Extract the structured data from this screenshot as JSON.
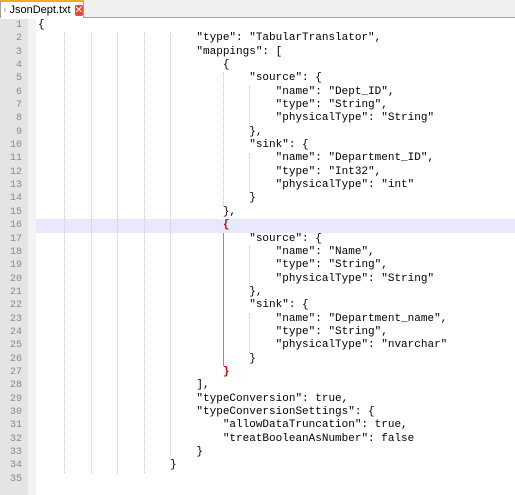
{
  "tab": {
    "title": "JsonDept.txt"
  },
  "editor": {
    "current_line": 16,
    "lines": [
      {
        "n": "1",
        "text": "{"
      },
      {
        "n": "2",
        "text": "                        \"type\": \"TabularTranslator\","
      },
      {
        "n": "3",
        "text": "                        \"mappings\": ["
      },
      {
        "n": "4",
        "text": "                            {"
      },
      {
        "n": "5",
        "text": "                                \"source\": {"
      },
      {
        "n": "6",
        "text": "                                    \"name\": \"Dept_ID\","
      },
      {
        "n": "7",
        "text": "                                    \"type\": \"String\","
      },
      {
        "n": "8",
        "text": "                                    \"physicalType\": \"String\""
      },
      {
        "n": "9",
        "text": "                                },"
      },
      {
        "n": "10",
        "text": "                                \"sink\": {"
      },
      {
        "n": "11",
        "text": "                                    \"name\": \"Department_ID\","
      },
      {
        "n": "12",
        "text": "                                    \"type\": \"Int32\","
      },
      {
        "n": "13",
        "text": "                                    \"physicalType\": \"int\""
      },
      {
        "n": "14",
        "text": "                                }"
      },
      {
        "n": "15",
        "text": "                            },"
      },
      {
        "n": "16",
        "text": "                            {"
      },
      {
        "n": "17",
        "text": "                                \"source\": {"
      },
      {
        "n": "18",
        "text": "                                    \"name\": \"Name\","
      },
      {
        "n": "19",
        "text": "                                    \"type\": \"String\","
      },
      {
        "n": "20",
        "text": "                                    \"physicalType\": \"String\""
      },
      {
        "n": "21",
        "text": "                                },"
      },
      {
        "n": "22",
        "text": "                                \"sink\": {"
      },
      {
        "n": "23",
        "text": "                                    \"name\": \"Department_name\","
      },
      {
        "n": "24",
        "text": "                                    \"type\": \"String\","
      },
      {
        "n": "25",
        "text": "                                    \"physicalType\": \"nvarchar\""
      },
      {
        "n": "26",
        "text": "                                }"
      },
      {
        "n": "27",
        "text": "                            }"
      },
      {
        "n": "28",
        "text": "                        ],"
      },
      {
        "n": "29",
        "text": "                        \"typeConversion\": true,"
      },
      {
        "n": "30",
        "text": "                        \"typeConversionSettings\": {"
      },
      {
        "n": "31",
        "text": "                            \"allowDataTruncation\": true,"
      },
      {
        "n": "32",
        "text": "                            \"treatBooleanAsNumber\": false"
      },
      {
        "n": "33",
        "text": "                        }"
      },
      {
        "n": "34",
        "text": "                    }"
      },
      {
        "n": "35",
        "text": ""
      }
    ]
  }
}
